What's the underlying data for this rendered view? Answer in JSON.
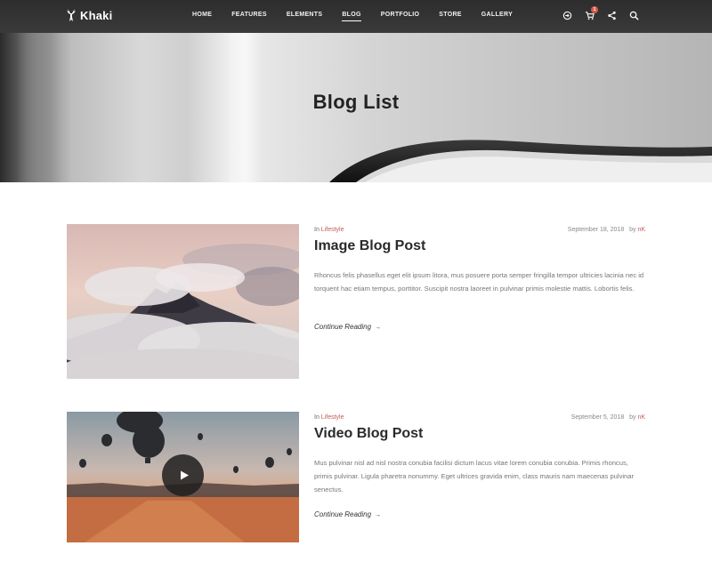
{
  "brand": {
    "name": "Khaki"
  },
  "nav": {
    "items": [
      {
        "label": "HOME"
      },
      {
        "label": "FEATURES"
      },
      {
        "label": "ELEMENTS"
      },
      {
        "label": "BLOG",
        "active": true
      },
      {
        "label": "PORTFOLIO"
      },
      {
        "label": "STORE"
      },
      {
        "label": "GALLERY"
      }
    ],
    "icons": [
      "sign-in-icon",
      "cart-icon",
      "share-icon",
      "search-icon"
    ],
    "cart_count": "1"
  },
  "hero": {
    "title": "Blog List"
  },
  "posts": [
    {
      "category_prefix": "In",
      "category": "Lifestyle",
      "date": "September 18, 2018",
      "by": "by",
      "author": "nK",
      "title": "Image Blog Post",
      "excerpt": "Rhoncus felis phasellus eget elit ipsum litora, mus posuere porta semper fringilla tempor ultricies lacinia nec id torquent hac etiam tempus, porttitor. Suscipit nostra laoreet in pulvinar primis molestie mattis. Lobortis felis.",
      "read_more": "Continue Reading"
    },
    {
      "category_prefix": "In",
      "category": "Lifestyle",
      "date": "September 5, 2018",
      "by": "by",
      "author": "nK",
      "title": "Video Blog Post",
      "excerpt": "Mus pulvinar nisl ad nisl nostra conubia facilisi dictum lacus vitae lorem conubia conubia. Primis rhoncus, primis pulvinar. Ligula pharetra nonummy. Eget ultrices gravida enim, class mauris nam maecenas pulvinar senectus.",
      "read_more": "Continue Reading"
    }
  ],
  "colors": {
    "accent": "#c25b5b",
    "navbar": "#333333",
    "badge": "#d75a4a"
  }
}
